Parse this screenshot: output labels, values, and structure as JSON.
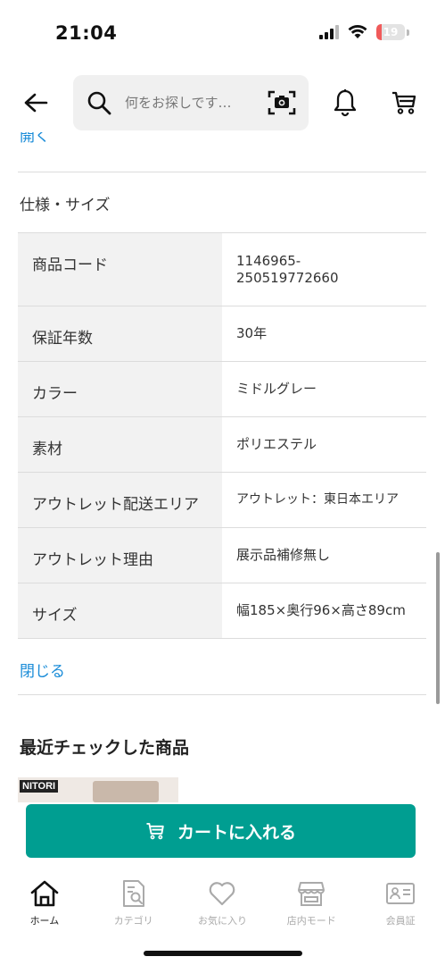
{
  "status_bar": {
    "time": "21:04",
    "battery_level": "19"
  },
  "header": {
    "search_placeholder": "何をお探しです…"
  },
  "content": {
    "open_link_label": "開く",
    "spec_title": "仕様・サイズ",
    "specs": [
      {
        "label": "商品コード",
        "value": "1146965-\n250519772660"
      },
      {
        "label": "保証年数",
        "value": "30年"
      },
      {
        "label": "カラー",
        "value": "ミドルグレー"
      },
      {
        "label": "素材",
        "value": "ポリエステル"
      },
      {
        "label": "アウトレット配送エリア",
        "value": "アウトレット：東日本エリア"
      },
      {
        "label": "アウトレット理由",
        "value": "展示品補修無し"
      },
      {
        "label": "サイズ",
        "value": "幅185×奥行96×高さ89cm"
      }
    ],
    "close_link_label": "閉じる",
    "recent_title": "最近チェックした商品",
    "recent_logo": "NITORI"
  },
  "add_to_cart_label": "カートに入れる",
  "bottom_nav": {
    "items": [
      {
        "label": "ホーム",
        "icon": "home-icon",
        "active": true
      },
      {
        "label": "カテゴリ",
        "icon": "category-icon",
        "active": false
      },
      {
        "label": "お気に入り",
        "icon": "heart-icon",
        "active": false
      },
      {
        "label": "店内モード",
        "icon": "store-icon",
        "active": false
      },
      {
        "label": "会員証",
        "icon": "member-card-icon",
        "active": false
      }
    ]
  },
  "colors": {
    "accent": "#009e91",
    "link": "#1a8cd8",
    "battery_low": "#f05a5a"
  }
}
